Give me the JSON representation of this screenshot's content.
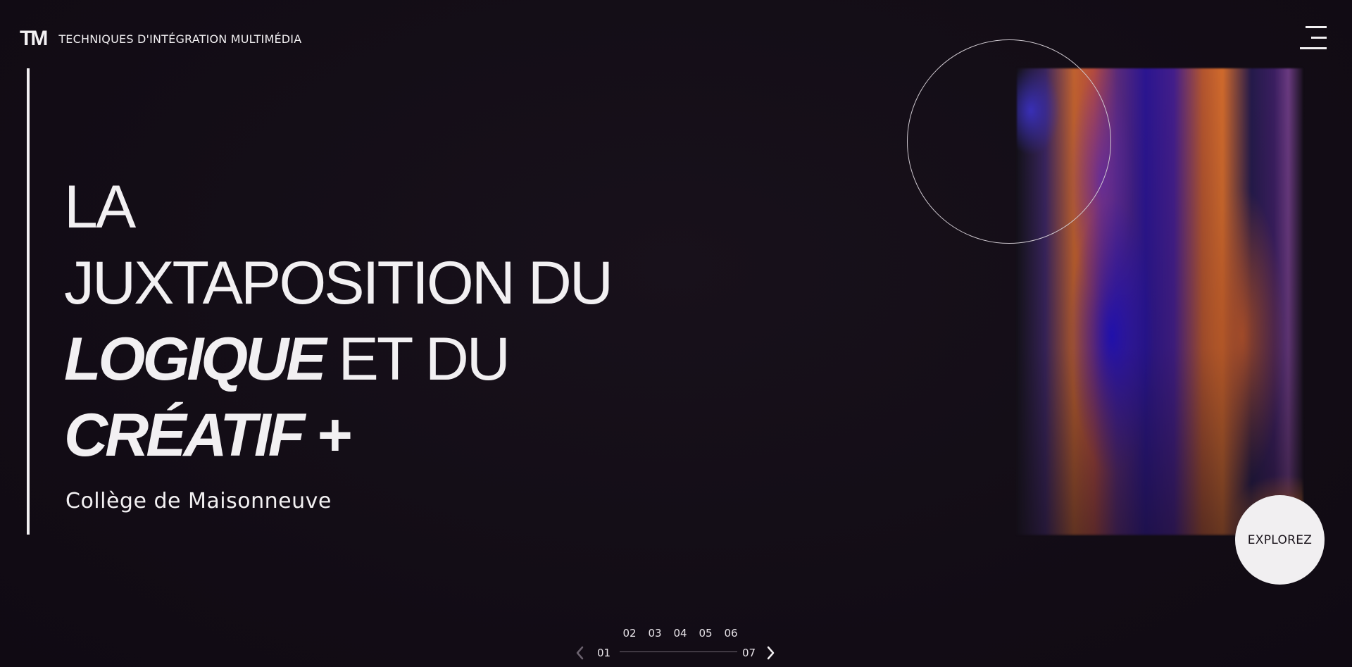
{
  "header": {
    "logo_mark": "TM",
    "logo_text": "TECHNIQUES D'INTÉGRATION MULTIMÉDIA",
    "menu_icon": "hamburger-menu-icon"
  },
  "hero": {
    "line1": "LA",
    "line2": "JUXTAPOSITION DU",
    "line3_bold": "LOGIQUE",
    "line3_thin": " ET DU",
    "line4_bold": "CRÉATIF +",
    "subtitle": "Collège de Maisonneuve",
    "explore_label": "EXPLOREZ"
  },
  "pager": {
    "pages": [
      "02",
      "03",
      "04",
      "05",
      "06"
    ],
    "first": "01",
    "last": "07",
    "prev_icon": "chevron-left-icon",
    "next_icon": "chevron-right-icon",
    "progress_fraction": 0
  },
  "colors": {
    "background": "#130d16",
    "text": "#f2f0f2",
    "button_bg": "#f1eff1"
  }
}
